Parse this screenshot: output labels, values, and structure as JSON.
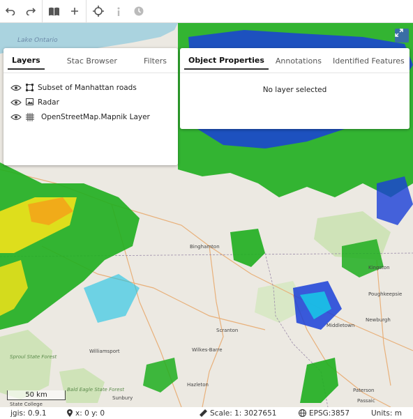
{
  "toolbar": {
    "buttons": [
      {
        "name": "undo-button",
        "icon": "undo-icon"
      },
      {
        "name": "redo-button",
        "icon": "redo-icon"
      },
      {
        "name": "open-book-button",
        "icon": "book-icon"
      },
      {
        "name": "add-button",
        "icon": "plus-icon"
      },
      {
        "name": "locate-button",
        "icon": "crosshair-icon"
      },
      {
        "name": "info-button",
        "icon": "info-icon"
      },
      {
        "name": "history-button",
        "icon": "clock-icon"
      }
    ]
  },
  "map": {
    "places": {
      "lake_ontario": "Lake Ontario",
      "binghamton": "Binghamton",
      "kingston": "Kingston",
      "poughkeepsie": "Poughkeepsie",
      "newburgh": "Newburgh",
      "middletown": "Middletown",
      "scranton": "Scranton",
      "wilkes_barre": "Wilkes-Barre",
      "williamsport": "Williamsport",
      "hazleton": "Hazleton",
      "sunbury": "Sunbury",
      "state_college": "State College",
      "sproul": "Sproul State Forest",
      "bald_eagle": "Bald Eagle State Forest",
      "paterson": "Paterson",
      "passaic": "Passaic"
    },
    "scale_label": "50 km"
  },
  "layers_panel": {
    "tabs": [
      "Layers",
      "Stac Browser",
      "Filters"
    ],
    "active_tab": "Layers",
    "layers": [
      {
        "name": "Subset of Manhattan roads",
        "type_icon": "vector-layer-icon"
      },
      {
        "name": "Radar",
        "type_icon": "image-layer-icon"
      },
      {
        "name": "OpenStreetMap.Mapnik Layer",
        "type_icon": "raster-grid-icon"
      }
    ]
  },
  "properties_panel": {
    "tabs": [
      "Object Properties",
      "Annotations",
      "Identified Features"
    ],
    "active_tab": "Object Properties",
    "empty_message": "No layer selected"
  },
  "status": {
    "version": "jgis: 0.9.1",
    "coords": "x: 0 y: 0",
    "scale": "Scale: 1: 3027651",
    "crs": "EPSG:3857",
    "units": "Units: m"
  },
  "colors": {
    "radar_green": "#1fae1f",
    "radar_blue": "#1a3fd8",
    "radar_cyan": "#19c3e6",
    "radar_yellow": "#f1e21a",
    "radar_orange": "#f3a51a",
    "water": "#aad3df",
    "land": "#ece9e2",
    "forest": "#cfe3b8"
  }
}
